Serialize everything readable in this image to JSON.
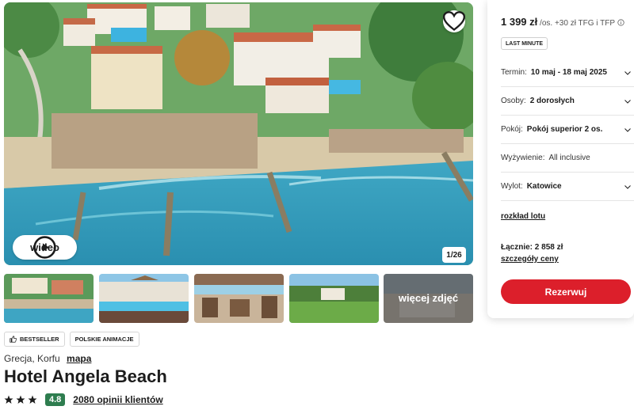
{
  "gallery": {
    "video_label": "wideo",
    "counter": "1/26",
    "more_photos_label": "więcej zdjęć"
  },
  "badges": [
    "BESTSELLER",
    "POLSKIE ANIMACJE"
  ],
  "hotel": {
    "location": "Grecja, Korfu",
    "map_link": "mapa",
    "name": "Hotel Angela Beach",
    "stars": 3,
    "score": "4.8",
    "reviews": "2080 opinii klientów"
  },
  "booking": {
    "price": "1 399 zł",
    "price_unit": "/os.",
    "fees": "+30 zł TFG i TFP",
    "tag": "LAST MINUTE",
    "fields": [
      {
        "label": "Termin:",
        "value": "10 maj - 18 maj 2025"
      },
      {
        "label": "Osoby:",
        "value": "2 dorosłych"
      },
      {
        "label": "Pokój:",
        "value": "Pokój superior 2 os."
      },
      {
        "label": "Wyżywienie:",
        "value": "All inclusive"
      },
      {
        "label": "Wylot:",
        "value": "Katowice"
      }
    ],
    "flight_link": "rozkład lotu",
    "total": "Łącznie: 2 858 zł",
    "details_link": "szczegóły ceny",
    "reserve_label": "Rezerwuj"
  },
  "colors": {
    "reserve_button": "#dc1f2b",
    "score_badge": "#2e7d4f"
  }
}
